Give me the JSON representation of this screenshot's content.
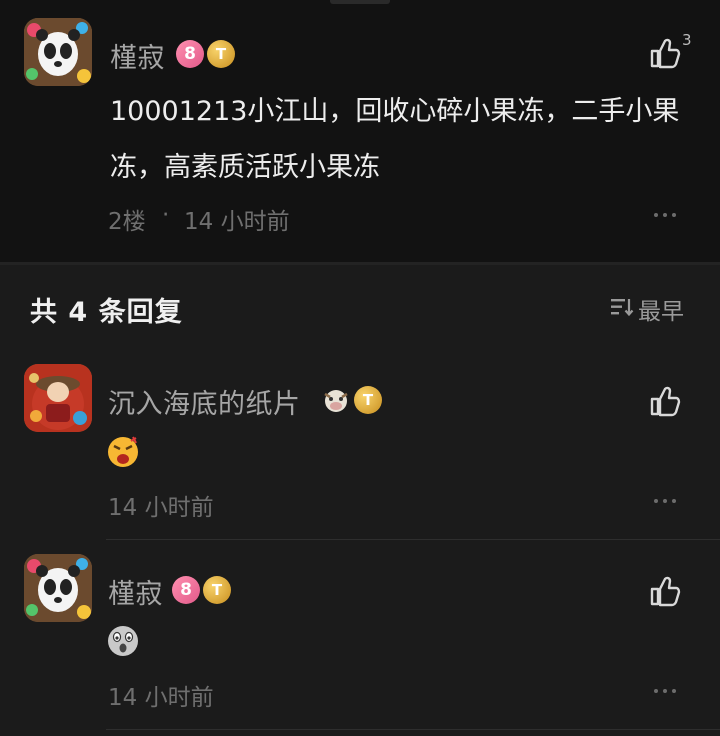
{
  "main_comment": {
    "user_name": "槿寂",
    "level_badge": "8",
    "vip_badge": "T",
    "text": "10001213小江山，回收心碎小果冻，二手小果冻，高素质活跃小果冻",
    "floor": "2楼",
    "separator": "·",
    "time": "14 小时前",
    "like_count": "3"
  },
  "replies_header": {
    "title": "共 4 条回复",
    "sort_label": "最早"
  },
  "replies": [
    {
      "user_name": "沉入海底的纸片",
      "vip_badge": "T",
      "emoji": "cry-emoji",
      "time": "14 小时前"
    },
    {
      "user_name": "槿寂",
      "level_badge": "8",
      "vip_badge": "T",
      "emoji": "shocked-emoji",
      "time": "14 小时前"
    }
  ],
  "colors": {
    "background": "#1b1b1b",
    "card_background": "#121212",
    "text_primary": "#ededed",
    "text_secondary": "#a6a6a6",
    "text_meta": "#6f6f6f",
    "level_badge": "#e25a8a",
    "vip_badge": "#d9a33a"
  }
}
